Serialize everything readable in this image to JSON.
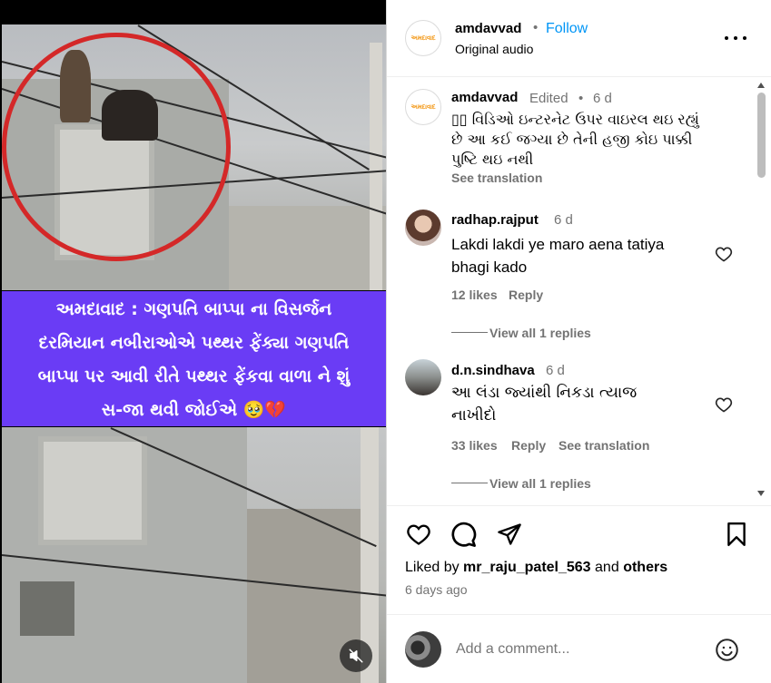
{
  "video": {
    "banner_lines": [
      "અમદાવાદ : ગણપતિ બાપ્પા ના વિસર્જન",
      "દરમિયાન નબીરાઓએ પથ્થર ફેંક્યા ગણપતિ",
      "બાપ્પા પર આવી રીતે પથ્થર ફેંકવા વાળા ને શું",
      "સ-જા થવી જોઈએ 🥹💔"
    ],
    "mute_icon": "speaker-muted-icon"
  },
  "header": {
    "avatar_text": "અમદાવાદ",
    "username": "amdavvad",
    "separator": "•",
    "follow_label": "Follow",
    "audio_label": "Original audio",
    "more_label": "•••"
  },
  "caption": {
    "username": "amdavvad",
    "edited": "Edited",
    "dot": "•",
    "time": "6 d",
    "lines": [
      "▯▯ વિડિઓ ઇન્ટરનેટ ઉપર વાઇરલ થઇ રહ્યું",
      "છે આ કઈ જગ્યા છે તેની હજી કોઇ પાક્કી",
      "પુષ્ટિ થઇ નથી"
    ],
    "see_translation": "See translation"
  },
  "comments": [
    {
      "username": "radhap.rajput",
      "time": "6 d",
      "lines": [
        "Lakdi lakdi ye maro aena tatiya",
        "bhagi kado"
      ],
      "likes": "12 likes",
      "reply": "Reply",
      "view_replies": "View all 1 replies"
    },
    {
      "username": "d.n.sindhava",
      "time": "6 d",
      "lines": [
        "આ લંડા જ્યાંથી નિકડા ત્યાજ",
        "નાખીદો"
      ],
      "likes": "33 likes",
      "reply": "Reply",
      "see_translation": "See translation",
      "view_replies": "View all 1 replies"
    }
  ],
  "actions": {
    "liked_by_prefix": "Liked by",
    "liked_by_user": "mr_raju_patel_563",
    "liked_by_and": "and",
    "liked_by_others": "others",
    "time_ago": "6 days ago"
  },
  "composer": {
    "placeholder": "Add a comment...",
    "emoji_icon": "smiley-icon"
  },
  "colors": {
    "banner": "#6a3cf5",
    "follow": "#0095f6",
    "circle": "#d42828"
  }
}
